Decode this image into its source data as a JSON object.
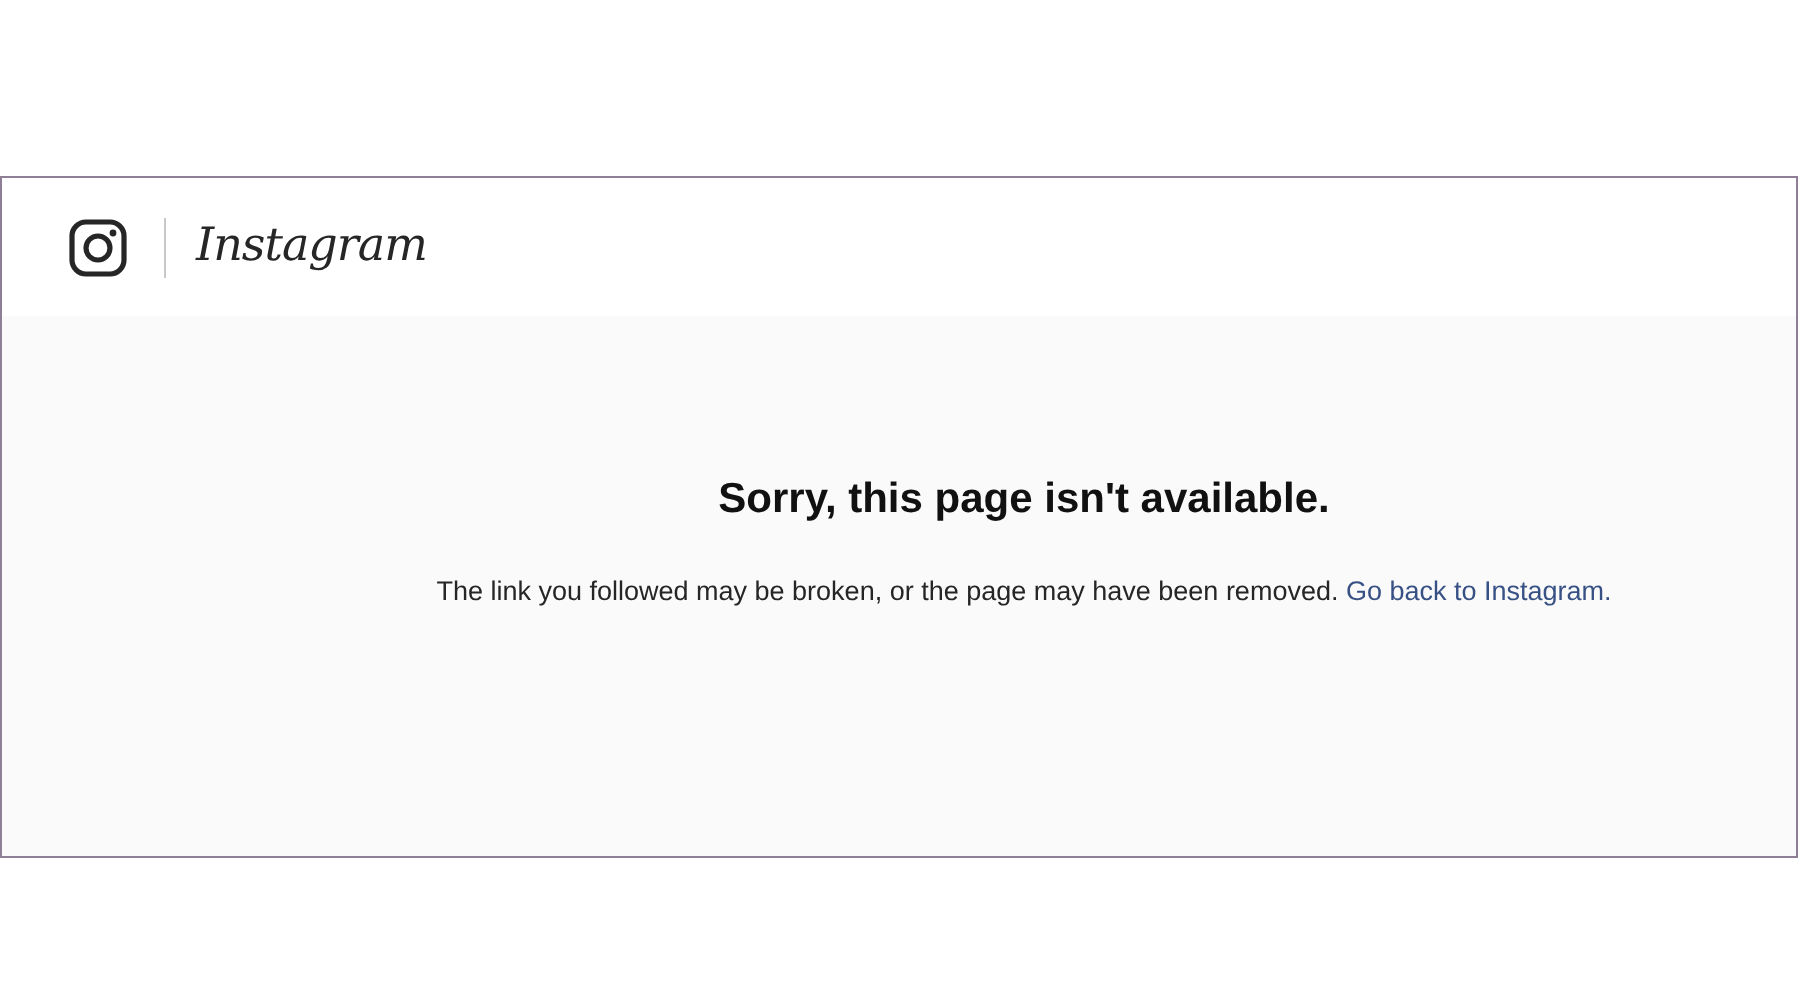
{
  "header": {
    "logo_text": "Instagram"
  },
  "error": {
    "title": "Sorry, this page isn't available.",
    "message": "The link you followed may be broken, or the page may have been removed.",
    "link": "Go back to Instagram."
  }
}
